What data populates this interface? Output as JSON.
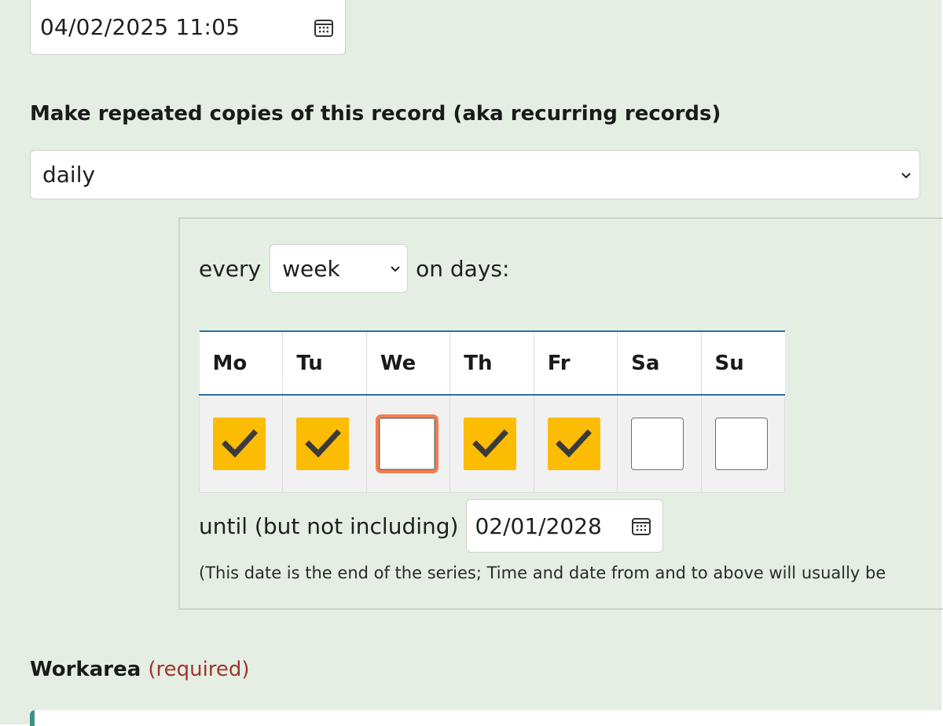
{
  "start": {
    "datetime_value": "04/02/2025 11:05",
    "calendar_icon": "calendar-icon"
  },
  "repeat": {
    "label": "Make repeated copies of this record (aka recurring records)",
    "frequency_value": "daily",
    "every_label": "every",
    "unit_value": "week",
    "on_days_label": "on days:",
    "days": [
      {
        "label": "Mo",
        "checked": true
      },
      {
        "label": "Tu",
        "checked": true
      },
      {
        "label": "We",
        "checked": false
      },
      {
        "label": "Th",
        "checked": true
      },
      {
        "label": "Fr",
        "checked": true
      },
      {
        "label": "Sa",
        "checked": false
      },
      {
        "label": "Su",
        "checked": false
      }
    ],
    "until_label": "until (but not including)",
    "until_value": "02/01/2028",
    "note": "(This date is the end of the series; Time and date from and to above will usually be"
  },
  "workarea": {
    "label": "Workarea",
    "required_label": "(required)"
  },
  "colors": {
    "panel_bg": "#e4eee3",
    "checkbox_checked": "#fcbc04",
    "focus_ring": "#f57c4f",
    "table_border_accent": "#2e6da4",
    "required_text": "#a0352d",
    "workarea_accent": "#3f8f85"
  }
}
